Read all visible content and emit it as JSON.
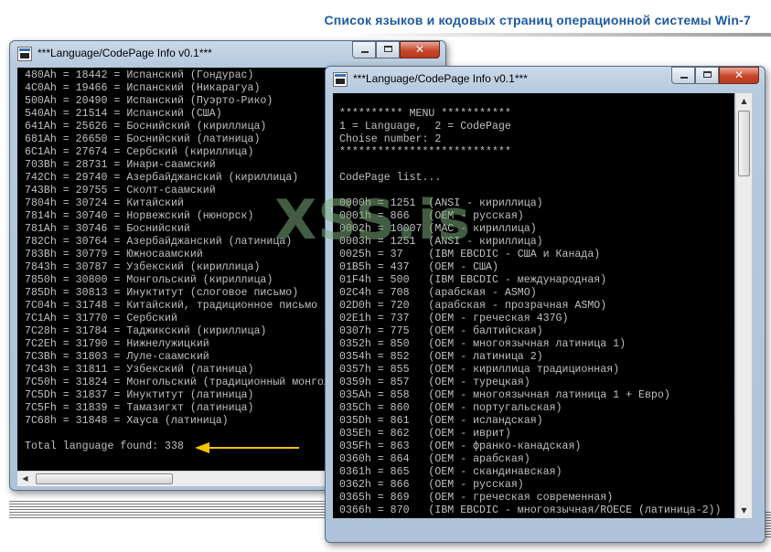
{
  "page_title": "Список языков и кодовых страниц операционной системы Win-7",
  "watermark": "XSS.is",
  "colors": {
    "title": "#1e5aa0",
    "console_background": "#000000",
    "console_text": "#c0c0c0",
    "annotation_arrow": "#f0c400",
    "close_button": "#c7452a"
  },
  "left_window": {
    "title": "***Language/CodePage Info v0.1***",
    "lines": [
      "480Ah = 18442 = Испанский (Гондурас)",
      "4C0Ah = 19466 = Испанский (Никарагуа)",
      "500Ah = 20490 = Испанский (Пуэрто-Рико)",
      "540Ah = 21514 = Испанский (США)",
      "641Ah = 25626 = Боснийский (кириллица)",
      "681Ah = 26650 = Боснийский (латиница)",
      "6C1Ah = 27674 = Сербский (кириллица)",
      "703Bh = 28731 = Инари-саамский",
      "742Ch = 29740 = Азербайджанский (кириллица)",
      "743Bh = 29755 = Сколт-саамский",
      "7804h = 30724 = Китайский",
      "7814h = 30740 = Норвежский (нюнорск)",
      "781Ah = 30746 = Боснийский",
      "782Ch = 30764 = Азербайджанский (латиница)",
      "783Bh = 30779 = Южносаамский",
      "7843h = 30787 = Узбекский (кириллица)",
      "7850h = 30800 = Монгольский (кириллица)",
      "785Dh = 30813 = Инуктитут (слоговое письмо)",
      "7C04h = 31748 = Китайский, традиционное письмо",
      "7C1Ah = 31770 = Сербский",
      "7C28h = 31784 = Таджикский (кириллица)",
      "7C2Eh = 31790 = Нижнелужицкий",
      "7C3Bh = 31803 = Луле-саамский",
      "7C43h = 31811 = Узбекский (латиница)",
      "7C50h = 31824 = Монгольский (традиционный монгол",
      "7C5Dh = 31837 = Инуктитут (латиница)",
      "7C5Fh = 31839 = Тамазигхт (латиница)",
      "7C68h = 31848 = Хауса (латиница)",
      "",
      "Total language found: 338"
    ]
  },
  "right_window": {
    "title": "***Language/CodePage Info v0.1***",
    "lines": [
      "",
      "********** MENU ***********",
      "1 = Language,  2 = CodePage",
      "Choise number: 2",
      "***************************",
      "",
      "CodePage list...",
      "",
      "0000h = 1251  (ANSI - кириллица)",
      "0001h = 866   (OEM - русская)",
      "0002h = 10007 (MAC - кириллица)",
      "0003h = 1251  (ANSI - кириллица)",
      "0025h = 37    (IBM EBCDIC - США и Канада)",
      "01B5h = 437   (OEM - США)",
      "01F4h = 500   (IBM EBCDIC - международная)",
      "02C4h = 708   (арабская - ASMO)",
      "02D0h = 720   (арабская - прозрачная ASMO)",
      "02E1h = 737   (OEM - греческая 437G)",
      "0307h = 775   (OEM - балтийская)",
      "0352h = 850   (OEM - многоязычная латиница 1)",
      "0354h = 852   (OEM - латиница 2)",
      "0357h = 855   (OEM - кириллица традиционная)",
      "0359h = 857   (OEM - турецкая)",
      "035Ah = 858   (OEM - многоязычная латиница 1 + Евро)",
      "035Ch = 860   (OEM - португальская)",
      "035Dh = 861   (OEM - исландская)",
      "035Eh = 862   (OEM - иврит)",
      "035Fh = 863   (OEM - франко-канадская)",
      "0360h = 864   (OEM - арабская)",
      "0361h = 865   (OEM - скандинавская)",
      "0362h = 866   (OEM - русская)",
      "0365h = 869   (OEM - греческая современная)",
      "0366h = 870   (IBM EBCDIC - многоязычная/ROECE (латиница-2))"
    ]
  }
}
